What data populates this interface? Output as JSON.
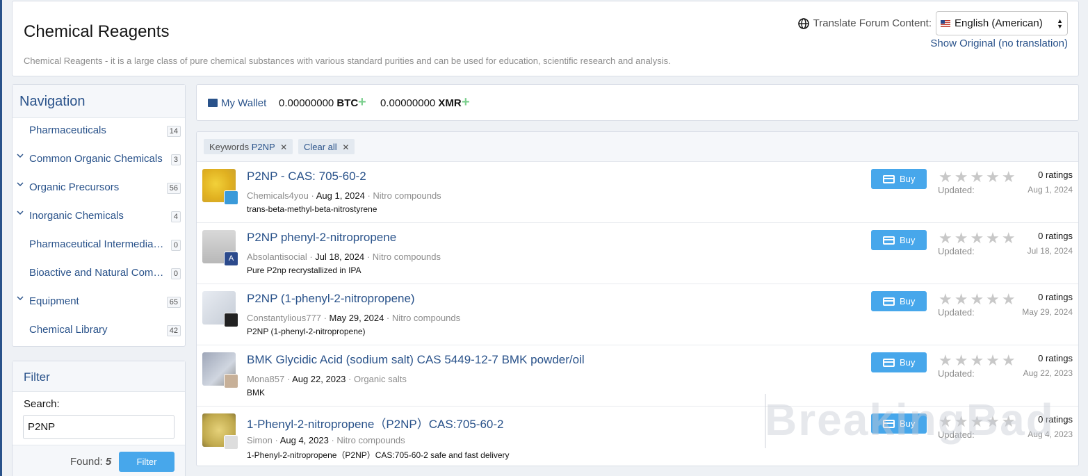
{
  "header": {
    "title": "Chemical Reagents",
    "description": "Chemical Reagents - it is a large class of pure chemical substances with various standard purities and can be used for education, scientific research and analysis.",
    "translate_label": "Translate Forum Content:",
    "language_selected": "English (American)",
    "show_original": "Show Original (no translation)"
  },
  "navigation": {
    "title": "Navigation",
    "items": [
      {
        "label": "Pharmaceuticals",
        "count": "14",
        "expandable": false
      },
      {
        "label": "Common Organic Chemicals",
        "count": "3",
        "expandable": true
      },
      {
        "label": "Organic Precursors",
        "count": "56",
        "expandable": true
      },
      {
        "label": "Inorganic Chemicals",
        "count": "4",
        "expandable": true
      },
      {
        "label": "Pharmaceutical Intermediates",
        "count": "0",
        "expandable": false
      },
      {
        "label": "Bioactive and Natural Com…",
        "count": "0",
        "expandable": false
      },
      {
        "label": "Equipment",
        "count": "65",
        "expandable": true
      },
      {
        "label": "Chemical Library",
        "count": "42",
        "expandable": false
      }
    ]
  },
  "filter": {
    "title": "Filter",
    "search_label": "Search:",
    "search_value": "P2NP",
    "found_label": "Found:",
    "found_count": "5",
    "button": "Filter"
  },
  "wallet": {
    "link": "My Wallet",
    "btc_amount": "0.00000000",
    "btc_unit": "BTC",
    "xmr_amount": "0.00000000",
    "xmr_unit": "XMR"
  },
  "active_filters": {
    "keyword_label": "Keywords",
    "keyword_value": "P2NP",
    "clear_all": "Clear all"
  },
  "listings": [
    {
      "title": "P2NP - CAS: 705-60-2",
      "seller": "Chemicals4you",
      "date": "Aug 1, 2024",
      "category": "Nitro compounds",
      "desc": "trans-beta-methyl-beta-nitrostyrene",
      "ratings": "0 ratings",
      "updated_label": "Updated:",
      "updated": "Aug 1, 2024",
      "buy": "Buy"
    },
    {
      "title": "P2NP phenyl-2-nitropropene",
      "seller": "Absolantisocial",
      "date": "Jul 18, 2024",
      "category": "Nitro compounds",
      "desc": "Pure P2np recrystallized in IPA",
      "ratings": "0 ratings",
      "updated_label": "Updated:",
      "updated": "Jul 18, 2024",
      "buy": "Buy",
      "avatar_letter": "A"
    },
    {
      "title": "P2NP (1-phenyl-2-nitropropene)",
      "seller": "Constantylious777",
      "date": "May 29, 2024",
      "category": "Nitro compounds",
      "desc": "P2NP (1-phenyl-2-nitropropene)",
      "ratings": "0 ratings",
      "updated_label": "Updated:",
      "updated": "May 29, 2024",
      "buy": "Buy"
    },
    {
      "title": "BMK Glycidic Acid (sodium salt) CAS 5449-12-7 BMK powder/oil",
      "seller": "Mona857",
      "date": "Aug 22, 2023",
      "category": "Organic salts",
      "desc": "BMK",
      "ratings": "0 ratings",
      "updated_label": "Updated:",
      "updated": "Aug 22, 2023",
      "buy": "Buy"
    },
    {
      "title": "1-Phenyl-2-nitropropene（P2NP）CAS:705-60-2",
      "seller": "Simon",
      "date": "Aug 4, 2023",
      "category": "Nitro compounds",
      "desc": "1-Phenyl-2-nitropropene（P2NP）CAS:705-60-2 safe and fast delivery",
      "ratings": "0 ratings",
      "updated_label": "Updated:",
      "updated": "Aug 4, 2023",
      "buy": "Buy"
    }
  ],
  "watermark": "BreakingBad"
}
